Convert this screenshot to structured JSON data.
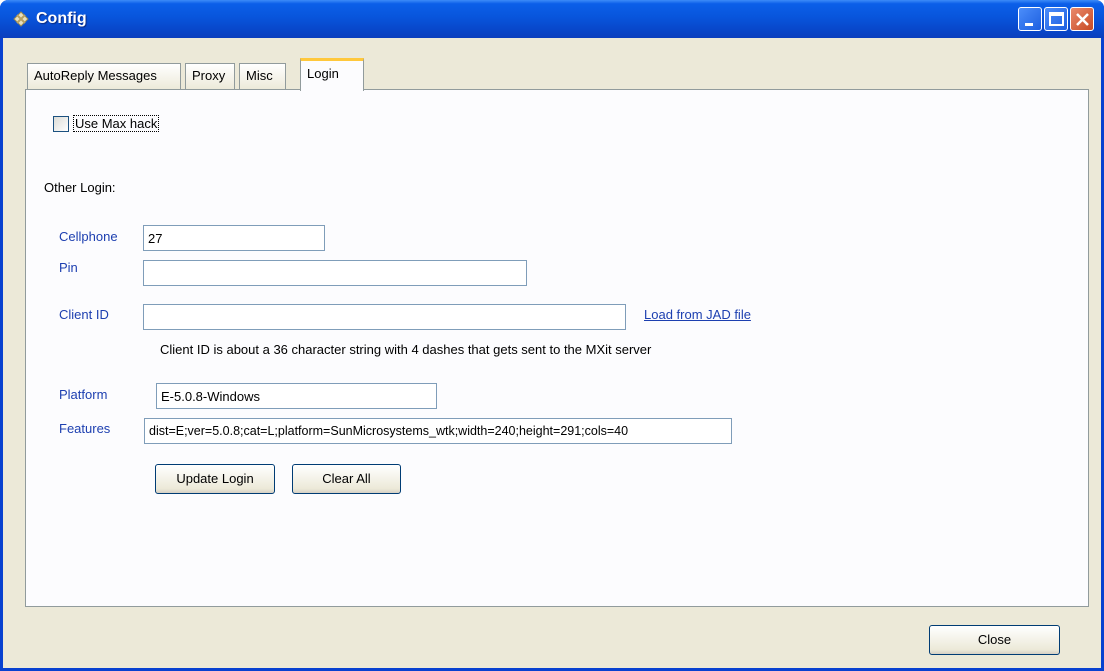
{
  "window": {
    "title": "Config"
  },
  "tabs": [
    {
      "label": "AutoReply Messages"
    },
    {
      "label": "Proxy"
    },
    {
      "label": "Misc"
    },
    {
      "label": "Login"
    }
  ],
  "login": {
    "max_hack_label": "Use Max hack",
    "max_hack_checked": false,
    "other_login_label": "Other Login:",
    "cellphone_label": "Cellphone",
    "cellphone_value": "27",
    "pin_label": "Pin",
    "pin_value": "",
    "client_id_label": "Client ID",
    "client_id_value": "",
    "load_jad_link": "Load from JAD file",
    "client_id_hint": "Client ID is about a 36 character string with 4 dashes that gets sent to the MXit server",
    "platform_label": "Platform",
    "platform_value": "E-5.0.8-Windows",
    "features_label": "Features",
    "features_value": "dist=E;ver=5.0.8;cat=L;platform=SunMicrosystems_wtk;width=240;height=291;cols=40",
    "update_button": "Update Login",
    "clear_button": "Clear All"
  },
  "footer": {
    "close_button": "Close"
  },
  "colors": {
    "titlebar": "#0855dc",
    "label_blue": "#1d3fb0",
    "active_tab_accent": "#ffc83c"
  }
}
